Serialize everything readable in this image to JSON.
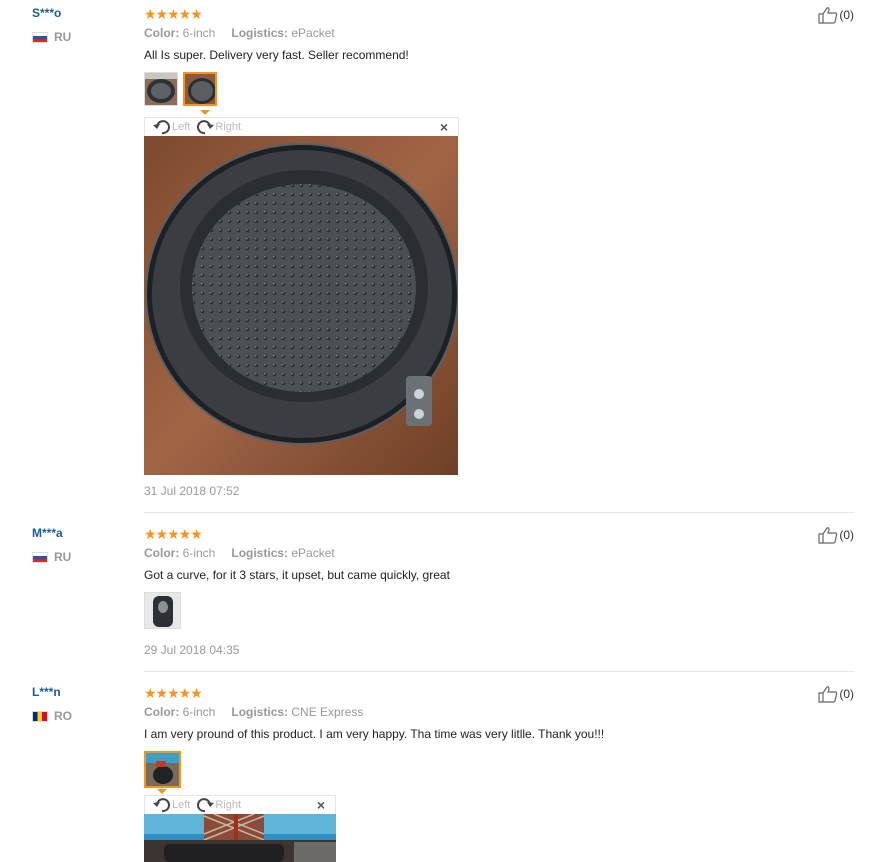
{
  "reviews": [
    {
      "user": "S***o",
      "country": "RU",
      "stars": "★★★★★",
      "color_label": "Color:",
      "color_value": "6-inch",
      "logistics_label": "Logistics:",
      "logistics_value": "ePacket",
      "text": "All Is super. Delivery very fast. Seller recommend!",
      "likes": "(0)",
      "date": "31 Jul 2018 07:52"
    },
    {
      "user": "M***a",
      "country": "RU",
      "stars": "★★★★★",
      "color_label": "Color:",
      "color_value": "6-inch",
      "logistics_label": "Logistics:",
      "logistics_value": "ePacket",
      "text": "Got a curve, for it 3 stars, it upset, but came quickly, great",
      "likes": "(0)",
      "date": "29 Jul 2018 04:35"
    },
    {
      "user": "L***n",
      "country": "RO",
      "stars": "★★★★★",
      "color_label": "Color:",
      "color_value": "6-inch",
      "logistics_label": "Logistics:",
      "logistics_value": "CNE Express",
      "text": "I am very pround of this product. I am very happy. Tha time was very litlle. Thank you!!!",
      "likes": "(0)"
    }
  ],
  "viewer": {
    "left_label": "Left",
    "right_label": "Right",
    "close_label": "×"
  },
  "colors": {
    "accent": "#f7941d",
    "username": "#1c5a9a",
    "muted": "#999999"
  },
  "icons": {
    "like": "thumbs-up-icon",
    "rotate_left": "rotate-left-icon",
    "rotate_right": "rotate-right-icon",
    "close": "close-icon"
  }
}
